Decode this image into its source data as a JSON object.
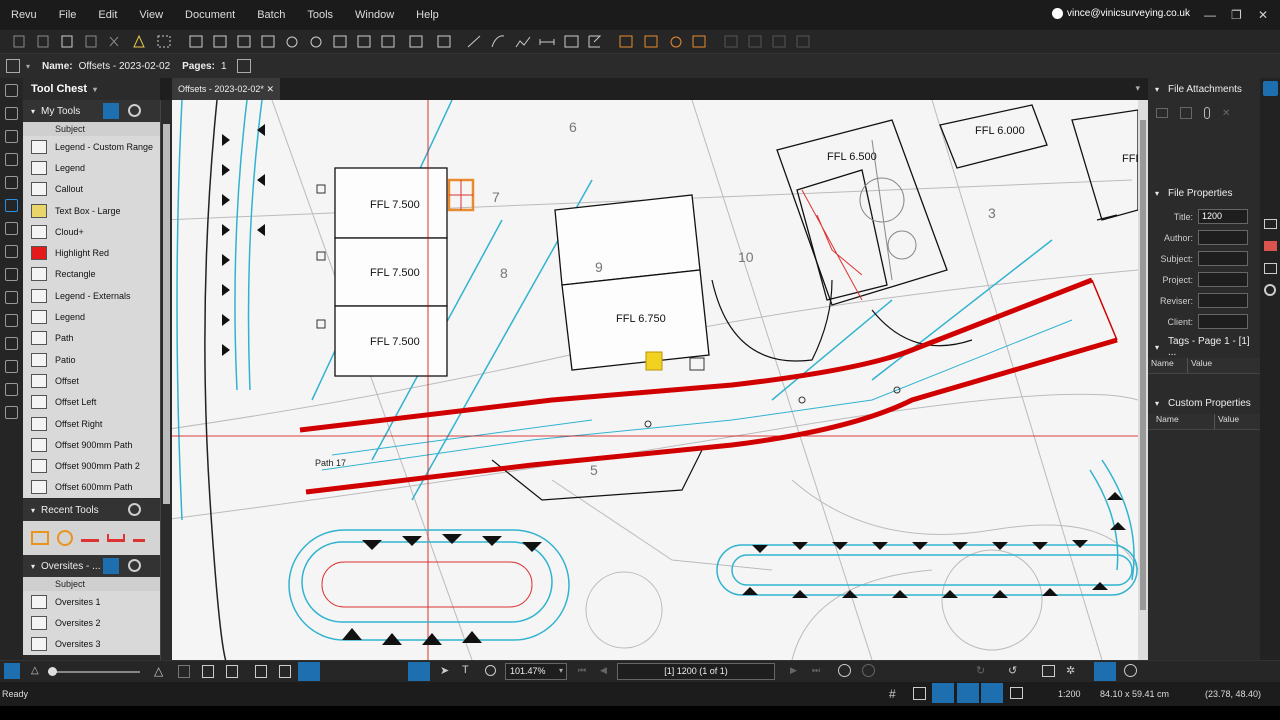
{
  "menu": [
    "Revu",
    "File",
    "Edit",
    "View",
    "Document",
    "Batch",
    "Tools",
    "Window",
    "Help"
  ],
  "account": "vince@vinicsurveying.co.uk",
  "doc": {
    "name_label": "Name:",
    "name": "Offsets - 2023-02-02",
    "pages_label": "Pages:",
    "pages": "1"
  },
  "tab": {
    "label": "Offsets - 2023-02-02*",
    "close": "✕"
  },
  "toolchest": {
    "title": "Tool Chest",
    "mytools": "My Tools",
    "subject_header": "Subject",
    "tools": [
      "Legend - Custom Range",
      "Legend",
      "Callout",
      "Text Box - Large",
      "Cloud+",
      "Highlight Red",
      "Rectangle",
      "Legend - Externals",
      "Legend",
      "Path",
      "Patio",
      "Offset",
      "Offset Left",
      "Offset Right",
      "Offset 900mm Path",
      "Offset 900mm Path 2",
      "Offset 600mm Path"
    ],
    "recent": "Recent Tools",
    "oversites": "Oversites - ...",
    "oversites_subject": "Subject",
    "oversite_items": [
      "Oversites 1",
      "Oversites 2",
      "Oversites 3"
    ]
  },
  "drawing": {
    "ffl": [
      "FFL 7.500",
      "FFL 7.500",
      "FFL 7.500",
      "FFL 6.750",
      "FFL 6.500",
      "FFL 6.000",
      "FFL"
    ],
    "plots": [
      "6",
      "7",
      "8",
      "9",
      "10",
      "3",
      "5"
    ],
    "path_label": "Path 17"
  },
  "right": {
    "attachments": "File Attachments",
    "properties": "File Properties",
    "props": [
      {
        "k": "Title:",
        "v": "1200"
      },
      {
        "k": "Author:",
        "v": ""
      },
      {
        "k": "Subject:",
        "v": ""
      },
      {
        "k": "Project:",
        "v": ""
      },
      {
        "k": "Reviser:",
        "v": ""
      },
      {
        "k": "Client:",
        "v": ""
      }
    ],
    "tags": "Tags - Page 1 - [1] ...",
    "name_col": "Name",
    "value_col": "Value",
    "custom": "Custom Properties"
  },
  "bottom": {
    "zoom": "101.47%",
    "page": "[1] 1200 (1 of 1)"
  },
  "status": {
    "ready": "Ready",
    "scale": "1:200",
    "size": "84.10 x 59.41 cm",
    "coords": "(23.78, 48.40)"
  },
  "colors": {
    "markup_red": "#d10000",
    "accent_blue": "#1e6fb0",
    "cyan": "#31b3d0",
    "highlight_red": "#e31b1b"
  }
}
